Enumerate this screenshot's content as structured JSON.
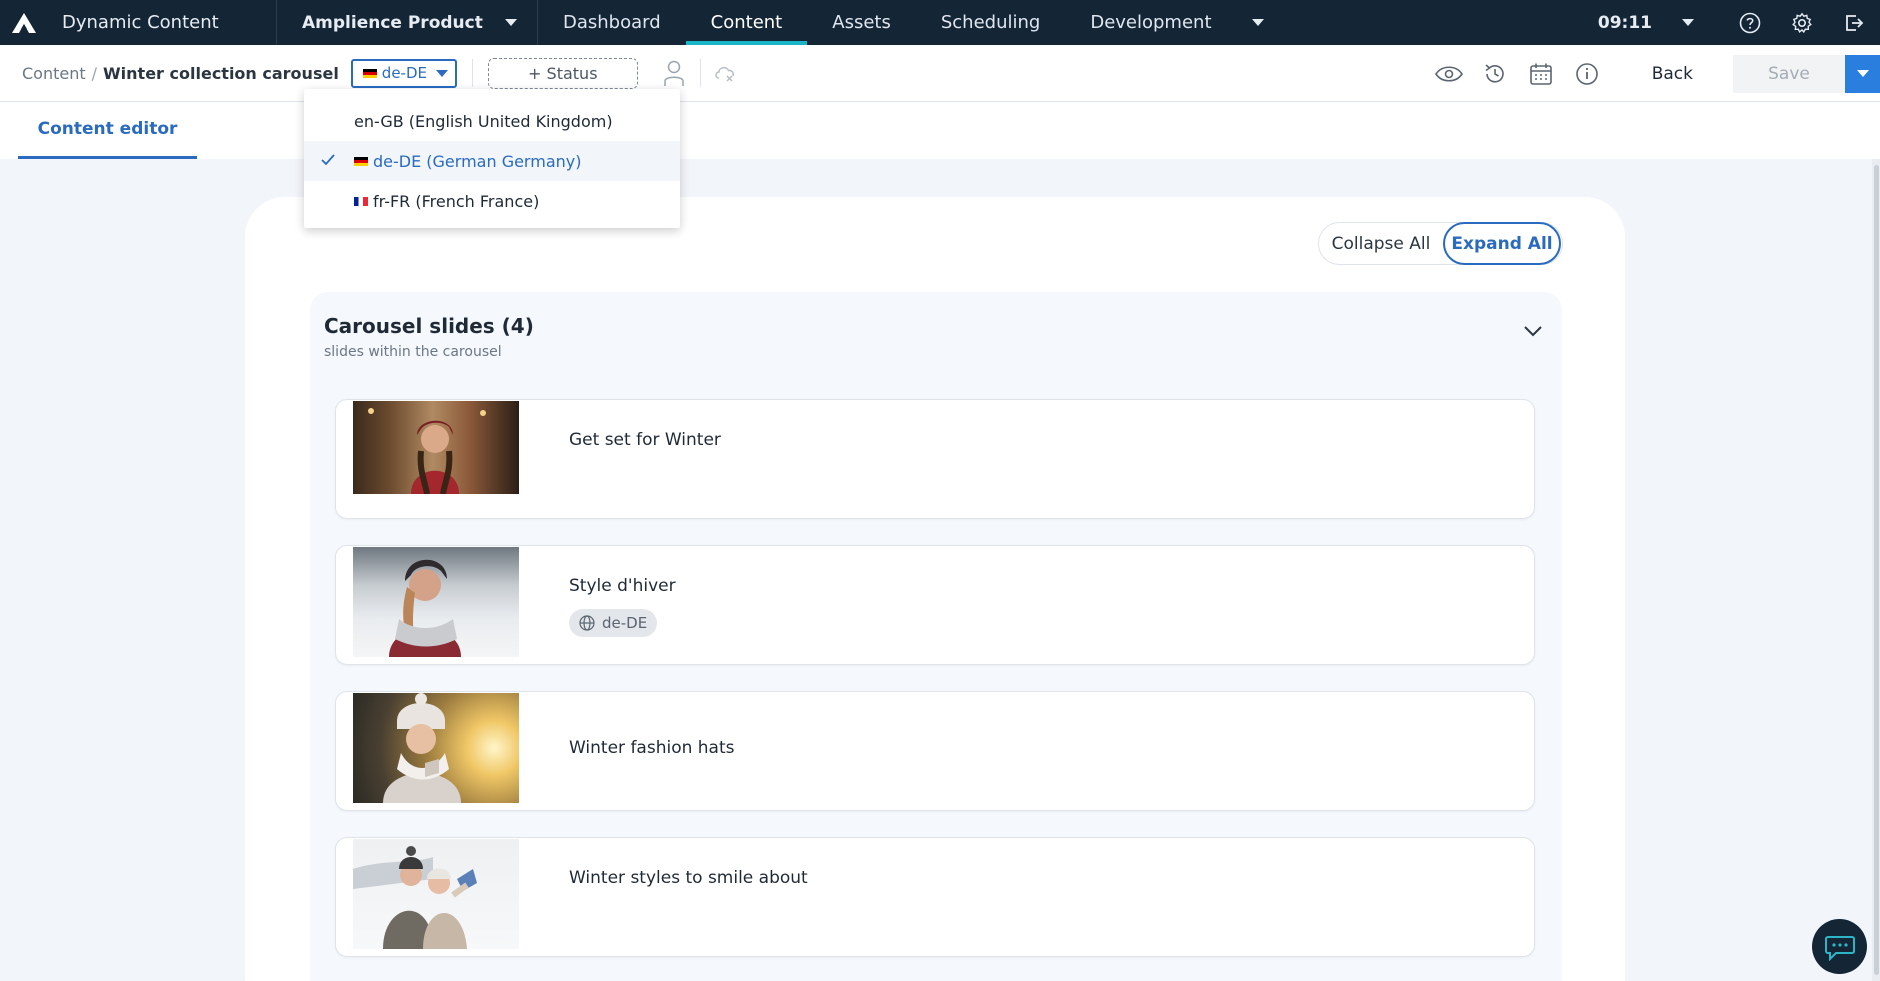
{
  "app": {
    "name": "Dynamic Content",
    "hub": "Amplience Product"
  },
  "nav": {
    "tabs": [
      "Dashboard",
      "Content",
      "Assets",
      "Scheduling",
      "Development"
    ],
    "active_tab": "Content",
    "time": "09:11",
    "icons": [
      "help-icon",
      "settings-icon",
      "logout-icon"
    ]
  },
  "toolbar": {
    "breadcrumb_root": "Content",
    "breadcrumb_sep": "/",
    "breadcrumb_current": "Winter collection carousel",
    "locale": "de-DE",
    "status_label": "+ Status",
    "back_label": "Back",
    "save_label": "Save"
  },
  "locale_menu": {
    "items": [
      {
        "label": "en-GB (English United Kingdom)",
        "flag": "none",
        "selected": false
      },
      {
        "label": "de-DE (German Germany)",
        "flag": "de",
        "selected": true
      },
      {
        "label": "fr-FR (French France)",
        "flag": "fr",
        "selected": false
      }
    ]
  },
  "editor": {
    "tab": "Content editor",
    "collapse_label": "Collapse All",
    "expand_label": "Expand All",
    "section_title": "Carousel slides (4)",
    "section_subtitle": "slides within the carousel",
    "slides": [
      {
        "title": "Get set for Winter"
      },
      {
        "title": "Style d'hiver",
        "locale": "de-DE"
      },
      {
        "title": "Winter fashion hats"
      },
      {
        "title": "Winter styles to smile about"
      }
    ]
  },
  "colors": {
    "nav_bg": "#142536",
    "accent": "#2a6bbf",
    "active_underline": "#1ab6c8",
    "save_dropdown": "#2a7fde"
  }
}
